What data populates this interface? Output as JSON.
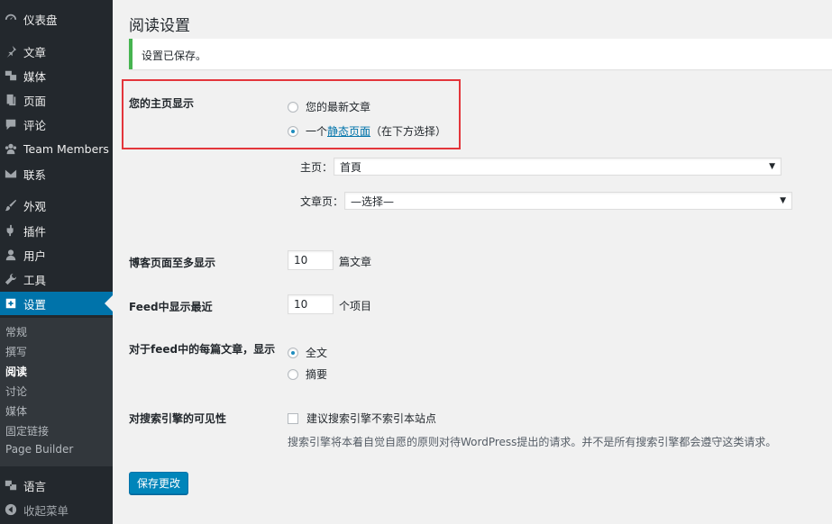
{
  "sidebar": {
    "items": [
      {
        "label": "仪表盘",
        "icon": "dashboard-icon"
      },
      {
        "label": "文章",
        "icon": "pushpin-icon"
      },
      {
        "label": "媒体",
        "icon": "media-icon"
      },
      {
        "label": "页面",
        "icon": "page-icon"
      },
      {
        "label": "评论",
        "icon": "comment-icon"
      },
      {
        "label": "Team Members",
        "icon": "team-icon"
      },
      {
        "label": "联系",
        "icon": "mail-icon"
      },
      {
        "label": "外观",
        "icon": "brush-icon"
      },
      {
        "label": "插件",
        "icon": "plugin-icon"
      },
      {
        "label": "用户",
        "icon": "user-icon"
      },
      {
        "label": "工具",
        "icon": "wrench-icon"
      },
      {
        "label": "设置",
        "icon": "settings-icon"
      }
    ],
    "submenu": [
      "常规",
      "撰写",
      "阅读",
      "讨论",
      "媒体",
      "固定链接",
      "Page Builder"
    ],
    "bottom": [
      {
        "label": "语言",
        "icon": "translate-icon"
      },
      {
        "label": "收起菜单",
        "icon": "collapse-icon"
      }
    ]
  },
  "main": {
    "title": "阅读设置",
    "notice": "设置已保存。",
    "homepage": {
      "label": "您的主页显示",
      "option_latest": "您的最新文章",
      "option_static_prefix": "一个",
      "option_static_link": "静态页面",
      "option_static_suffix": "（在下方选择）",
      "front_label": "主页：",
      "front_value": "首頁",
      "posts_label": "文章页：",
      "posts_value": "—选择—"
    },
    "blog_pages": {
      "label": "博客页面至多显示",
      "value": "10",
      "unit": "篇文章"
    },
    "feed_recent": {
      "label": "Feed中显示最近",
      "value": "10",
      "unit": "个项目"
    },
    "feed_full": {
      "label": "对于feed中的每篇文章，显示",
      "option_full": "全文",
      "option_summary": "摘要"
    },
    "visibility": {
      "label": "对搜索引擎的可见性",
      "checkbox": "建议搜索引擎不索引本站点",
      "description": "搜索引擎将本着自觉自愿的原则对待WordPress提出的请求。并不是所有搜索引擎都会遵守这类请求。"
    },
    "save_button": "保存更改"
  },
  "colors": {
    "sidebar": "#23282d",
    "accent": "#0073aa",
    "highlight": "#e3353b",
    "notice": "#46b450"
  }
}
